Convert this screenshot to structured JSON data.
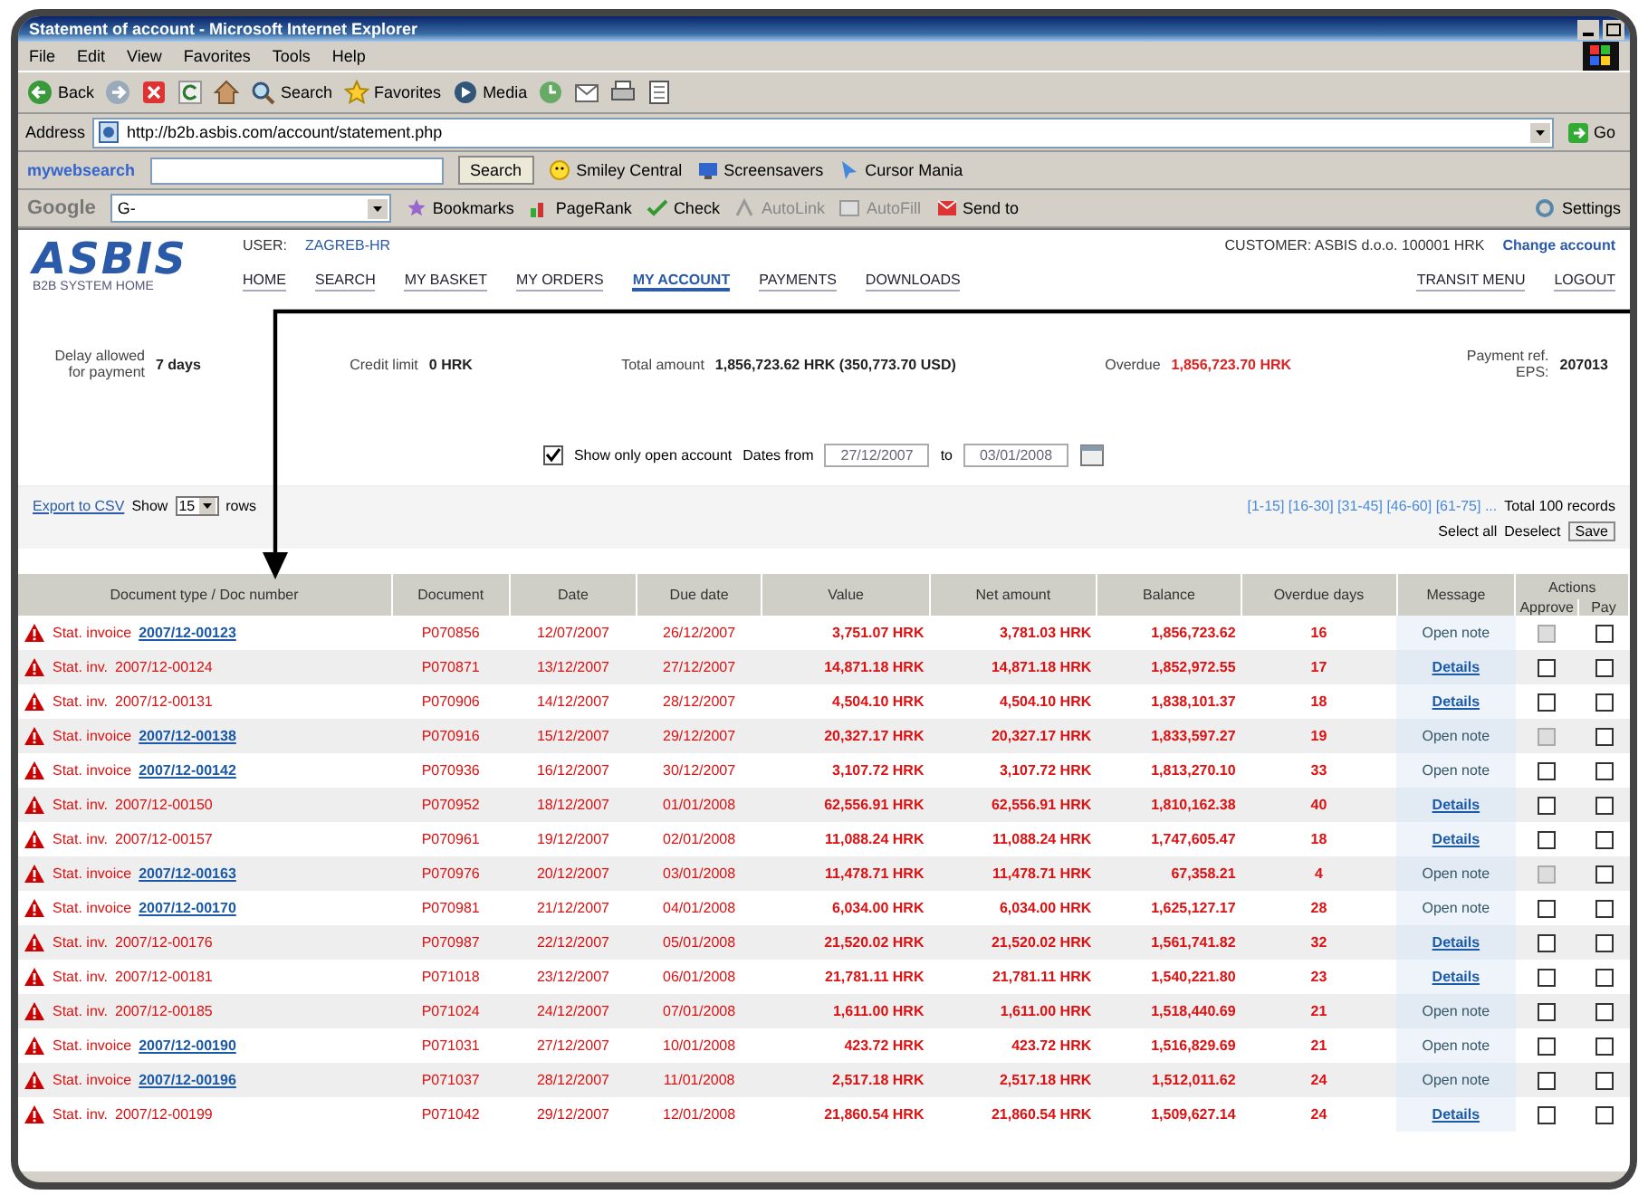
{
  "window": {
    "title": "Statement of account - Microsoft Internet Explorer"
  },
  "menu": [
    "File",
    "Edit",
    "View",
    "Favorites",
    "Tools",
    "Help"
  ],
  "toolbar": {
    "back": "Back",
    "buttons": [
      "Search",
      "Favorites",
      "Media"
    ]
  },
  "address_bar": {
    "label": "Address",
    "url": "http://b2b.asbis.com/account/statement.php",
    "go": "Go"
  },
  "search_bar": {
    "brand": "mywebsearch",
    "button": "Search",
    "links": [
      "Smiley Central",
      "Screensavers",
      "Cursor Mania"
    ]
  },
  "google_bar": {
    "brand": "Google",
    "field": "G-",
    "links": [
      "Bookmarks",
      "PageRank",
      "Check",
      "AutoLink",
      "AutoFill",
      "Send to"
    ],
    "settings": "Settings"
  },
  "site": {
    "logo": "ASBIS",
    "tagline": "B2B SYSTEM HOME",
    "user_label": "USER:",
    "user": "ZAGREB-HR",
    "company": "CUSTOMER: ASBIS d.o.o. 100001 HRK",
    "account_link": "Change account"
  },
  "nav": [
    {
      "label": "HOME",
      "selected": false
    },
    {
      "label": "SEARCH",
      "selected": false
    },
    {
      "label": "MY BASKET",
      "selected": false
    },
    {
      "label": "MY ORDERS",
      "selected": false
    },
    {
      "label": "MY ACCOUNT",
      "selected": true
    },
    {
      "label": "PAYMENTS",
      "selected": false
    },
    {
      "label": "DOWNLOADS",
      "selected": false
    }
  ],
  "nav_right": [
    "TRANSIT MENU",
    "LOGOUT"
  ],
  "summary": [
    {
      "label": "Delay allowed for payment",
      "value": "7 days",
      "alert": false
    },
    {
      "label": "Credit limit",
      "value": "0 HRK",
      "alert": false
    },
    {
      "label": "Total amount",
      "value": "1,856,723.62 HRK (350,773.70 USD)",
      "alert": false
    },
    {
      "label": "Overdue",
      "value": "1,856,723.70 HRK",
      "alert": true
    },
    {
      "label": "Payment ref. EPS:",
      "value": "207013",
      "alert": false
    }
  ],
  "filter": {
    "show_open": {
      "label": "Show only open account",
      "checked": true
    },
    "from_label": "Dates from",
    "from": "27/12/2007",
    "to_label": "to",
    "to": "03/01/2008"
  },
  "list_tools": {
    "export": "Export to CSV",
    "show": "Show",
    "rows": "15",
    "rows_suffix": "rows",
    "pages": "[1-15] [16-30] [31-45] [46-60] [61-75] ...",
    "total": "Total 100 records",
    "select_all": "Select all",
    "deselect": "Deselect",
    "save": "Save"
  },
  "table": {
    "columns": [
      "Document type / Doc number",
      "Document",
      "Date",
      "Due date",
      "Value",
      "Net amount",
      "Balance",
      "Overdue days",
      "Message"
    ],
    "actions": "Actions",
    "action_columns": [
      "Approve",
      "Pay"
    ],
    "rows": [
      {
        "doc_type": "Stat. invoice",
        "doc_number": "2007/12-00123",
        "linked": true,
        "document": "P070856",
        "date": "12/07/2007",
        "due_date": "26/12/2007",
        "value": "3,751.07 HRK",
        "net_amount": "3,781.03 HRK",
        "balance": "1,856,723.62",
        "overdue_days": "16",
        "message": "Open note",
        "message_link": false,
        "approve_disabled": true,
        "pay_checked": false
      },
      {
        "doc_type": "Stat. inv.",
        "doc_number": "2007/12-00124",
        "linked": false,
        "document": "P070871",
        "date": "13/12/2007",
        "due_date": "27/12/2007",
        "value": "14,871.18 HRK",
        "net_amount": "14,871.18 HRK",
        "balance": "1,852,972.55",
        "overdue_days": "17",
        "message": "Details",
        "message_link": true,
        "approve_disabled": false,
        "pay_checked": false
      },
      {
        "doc_type": "Stat. inv.",
        "doc_number": "2007/12-00131",
        "linked": false,
        "document": "P070906",
        "date": "14/12/2007",
        "due_date": "28/12/2007",
        "value": "4,504.10 HRK",
        "net_amount": "4,504.10 HRK",
        "balance": "1,838,101.37",
        "overdue_days": "18",
        "message": "Details",
        "message_link": true,
        "approve_disabled": false,
        "pay_checked": false
      },
      {
        "doc_type": "Stat. invoice",
        "doc_number": "2007/12-00138",
        "linked": true,
        "document": "P070916",
        "date": "15/12/2007",
        "due_date": "29/12/2007",
        "value": "20,327.17 HRK",
        "net_amount": "20,327.17 HRK",
        "balance": "1,833,597.27",
        "overdue_days": "19",
        "message": "Open note",
        "message_link": false,
        "approve_disabled": true,
        "pay_checked": false
      },
      {
        "doc_type": "Stat. invoice",
        "doc_number": "2007/12-00142",
        "linked": true,
        "document": "P070936",
        "date": "16/12/2007",
        "due_date": "30/12/2007",
        "value": "3,107.72 HRK",
        "net_amount": "3,107.72 HRK",
        "balance": "1,813,270.10",
        "overdue_days": "33",
        "message": "Open note",
        "message_link": false,
        "approve_disabled": false,
        "pay_checked": false
      },
      {
        "doc_type": "Stat. inv.",
        "doc_number": "2007/12-00150",
        "linked": false,
        "document": "P070952",
        "date": "18/12/2007",
        "due_date": "01/01/2008",
        "value": "62,556.91 HRK",
        "net_amount": "62,556.91 HRK",
        "balance": "1,810,162.38",
        "overdue_days": "40",
        "message": "Details",
        "message_link": true,
        "approve_disabled": false,
        "pay_checked": false
      },
      {
        "doc_type": "Stat. inv.",
        "doc_number": "2007/12-00157",
        "linked": false,
        "document": "P070961",
        "date": "19/12/2007",
        "due_date": "02/01/2008",
        "value": "11,088.24 HRK",
        "net_amount": "11,088.24 HRK",
        "balance": "1,747,605.47",
        "overdue_days": "18",
        "message": "Details",
        "message_link": true,
        "approve_disabled": false,
        "pay_checked": false
      },
      {
        "doc_type": "Stat. invoice",
        "doc_number": "2007/12-00163",
        "linked": true,
        "document": "P070976",
        "date": "20/12/2007",
        "due_date": "03/01/2008",
        "value": "11,478.71 HRK",
        "net_amount": "11,478.71 HRK",
        "balance": "67,358.21",
        "overdue_days": "4",
        "message": "Open note",
        "message_link": false,
        "approve_disabled": true,
        "pay_checked": false
      },
      {
        "doc_type": "Stat. invoice",
        "doc_number": "2007/12-00170",
        "linked": true,
        "document": "P070981",
        "date": "21/12/2007",
        "due_date": "04/01/2008",
        "value": "6,034.00 HRK",
        "net_amount": "6,034.00 HRK",
        "balance": "1,625,127.17",
        "overdue_days": "28",
        "message": "Open note",
        "message_link": false,
        "approve_disabled": false,
        "pay_checked": false
      },
      {
        "doc_type": "Stat. inv.",
        "doc_number": "2007/12-00176",
        "linked": false,
        "document": "P070987",
        "date": "22/12/2007",
        "due_date": "05/01/2008",
        "value": "21,520.02 HRK",
        "net_amount": "21,520.02 HRK",
        "balance": "1,561,741.82",
        "overdue_days": "32",
        "message": "Details",
        "message_link": true,
        "approve_disabled": false,
        "pay_checked": false
      },
      {
        "doc_type": "Stat. inv.",
        "doc_number": "2007/12-00181",
        "linked": false,
        "document": "P071018",
        "date": "23/12/2007",
        "due_date": "06/01/2008",
        "value": "21,781.11 HRK",
        "net_amount": "21,781.11 HRK",
        "balance": "1,540,221.80",
        "overdue_days": "23",
        "message": "Details",
        "message_link": true,
        "approve_disabled": false,
        "pay_checked": false
      },
      {
        "doc_type": "Stat. inv.",
        "doc_number": "2007/12-00185",
        "linked": false,
        "document": "P071024",
        "date": "24/12/2007",
        "due_date": "07/01/2008",
        "value": "1,611.00 HRK",
        "net_amount": "1,611.00 HRK",
        "balance": "1,518,440.69",
        "overdue_days": "21",
        "message": "Open note",
        "message_link": false,
        "approve_disabled": false,
        "pay_checked": false
      },
      {
        "doc_type": "Stat. invoice",
        "doc_number": "2007/12-00190",
        "linked": true,
        "document": "P071031",
        "date": "27/12/2007",
        "due_date": "10/01/2008",
        "value": "423.72 HRK",
        "net_amount": "423.72 HRK",
        "balance": "1,516,829.69",
        "overdue_days": "21",
        "message": "Open note",
        "message_link": false,
        "approve_disabled": false,
        "pay_checked": false
      },
      {
        "doc_type": "Stat. invoice",
        "doc_number": "2007/12-00196",
        "linked": true,
        "document": "P071037",
        "date": "28/12/2007",
        "due_date": "11/01/2008",
        "value": "2,517.18 HRK",
        "net_amount": "2,517.18 HRK",
        "balance": "1,512,011.62",
        "overdue_days": "24",
        "message": "Open note",
        "message_link": false,
        "approve_disabled": false,
        "pay_checked": false
      },
      {
        "doc_type": "Stat. inv.",
        "doc_number": "2007/12-00199",
        "linked": false,
        "document": "P071042",
        "date": "29/12/2007",
        "due_date": "12/01/2008",
        "value": "21,860.54 HRK",
        "net_amount": "21,860.54 HRK",
        "balance": "1,509,627.14",
        "overdue_days": "24",
        "message": "Details",
        "message_link": true,
        "approve_disabled": false,
        "pay_checked": false
      }
    ]
  }
}
